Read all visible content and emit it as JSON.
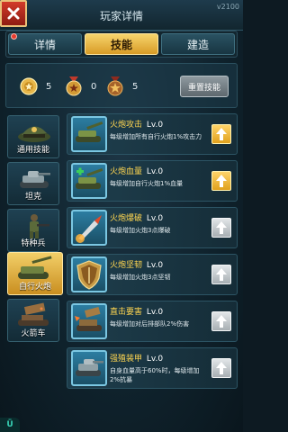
{
  "header": {
    "title": "玩家详情",
    "version": "v2100"
  },
  "tabs": [
    {
      "label": "详情",
      "active": false,
      "has_notification": true
    },
    {
      "label": "技能",
      "active": true,
      "has_notification": false
    },
    {
      "label": "建造",
      "active": false,
      "has_notification": false
    }
  ],
  "ranks": {
    "medal_1_count": "5",
    "medal_2_count": "0",
    "medal_3_count": "5",
    "reset_label": "重置技能"
  },
  "sidebar": [
    {
      "label": "通用技能",
      "icon": "officer-cap-icon",
      "active": false
    },
    {
      "label": "坦克",
      "icon": "tank-icon",
      "active": false
    },
    {
      "label": "特种兵",
      "icon": "soldier-icon",
      "active": false
    },
    {
      "label": "自行火炮",
      "icon": "artillery-icon",
      "active": true
    },
    {
      "label": "火箭车",
      "icon": "rocket-launcher-icon",
      "active": false
    }
  ],
  "skills": [
    {
      "name": "火炮攻击",
      "level": "Lv.0",
      "desc": "每级增加所有自行火炮1%攻击力",
      "icon": "artillery-attack-icon",
      "upgradable": true
    },
    {
      "name": "火炮血量",
      "level": "Lv.0",
      "desc": "每级增加自行火炮1%血量",
      "icon": "artillery-hp-icon",
      "upgradable": true
    },
    {
      "name": "火炮爆破",
      "level": "Lv.0",
      "desc": "每级增加火炮3点爆破",
      "icon": "missile-blast-icon",
      "upgradable": false
    },
    {
      "name": "火炮坚韧",
      "level": "Lv.0",
      "desc": "每级增加火炮3点坚韧",
      "icon": "shield-icon",
      "upgradable": false
    },
    {
      "name": "直击要害",
      "level": "Lv.0",
      "desc": "每级增加对后排部队2%伤害",
      "icon": "artillery-strike-icon",
      "upgradable": false
    },
    {
      "name": "强殖装甲",
      "level": "Lv.0",
      "desc": "自身血量高于60%时，每级增加2%抗暴",
      "icon": "armor-icon",
      "upgradable": false
    }
  ],
  "colors": {
    "accent_gold": "#f2c14e",
    "skill_name": "#ffd650",
    "close_red": "#c9301f"
  },
  "corner_logo": "Ü"
}
